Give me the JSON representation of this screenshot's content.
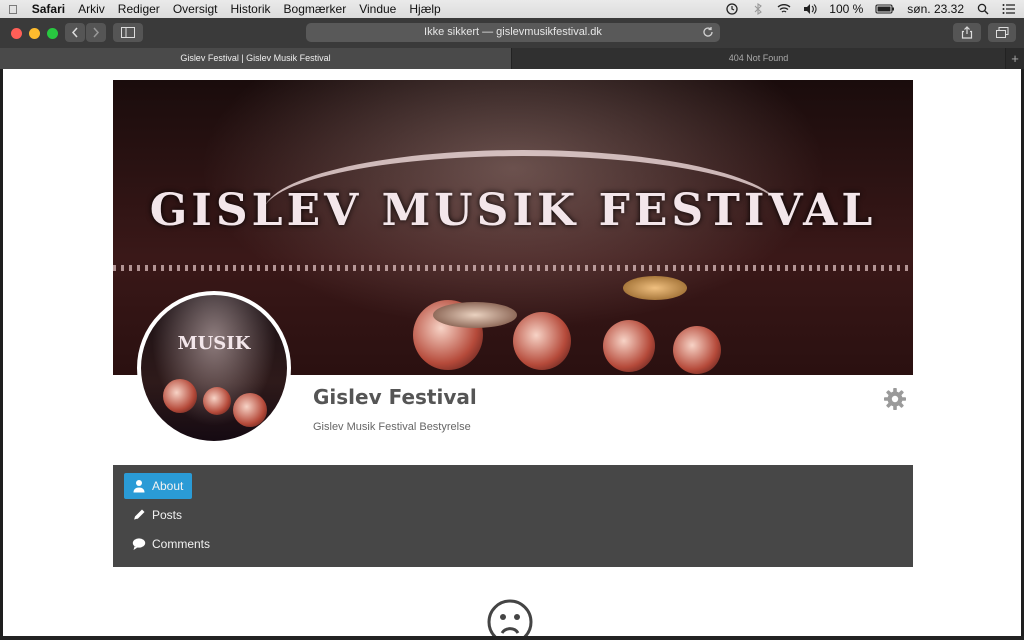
{
  "menubar": {
    "app": "Safari",
    "menus": [
      "Arkiv",
      "Rediger",
      "Oversigt",
      "Historik",
      "Bogmærker",
      "Vindue",
      "Hjælp"
    ],
    "battery": "100 %",
    "clock": "søn. 23.32"
  },
  "toolbar": {
    "url": "Ikke sikkert — gislevmusikfestival.dk"
  },
  "tabs": [
    {
      "label": "Gislev Festival | Gislev Musik Festival"
    },
    {
      "label": "404 Not Found"
    }
  ],
  "profile": {
    "name": "Gislev Festival",
    "subtitle": "Gislev Musik Festival Bestyrelse"
  },
  "cover": {
    "banner_text": "GISLEV MUSIK FESTIVAL",
    "avatar_text": "MUSIK"
  },
  "nav": {
    "items": [
      {
        "label": "About",
        "icon": "user-icon"
      },
      {
        "label": "Posts",
        "icon": "pencil-icon"
      },
      {
        "label": "Comments",
        "icon": "comment-icon"
      }
    ]
  },
  "colors": {
    "accent": "#2a9bd6",
    "nav_bg": "#474747"
  }
}
